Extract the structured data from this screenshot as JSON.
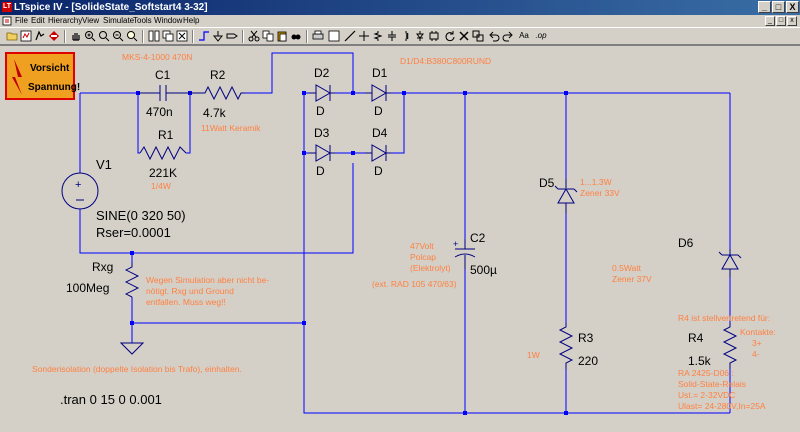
{
  "window": {
    "title": "LTspice IV - [SolideState_Softstart4  3-32]",
    "controls": [
      "_",
      "□",
      "X"
    ],
    "mdi_controls": [
      "_",
      "□",
      "x"
    ]
  },
  "menu": [
    "File",
    "Edit",
    "Hierarchy",
    "View",
    "Simulate",
    "Tools",
    "Window",
    "Help"
  ],
  "toolbar": {
    "text_tools": [
      "Aa",
      ".op"
    ]
  },
  "schematic": {
    "colors": {
      "wire": "#0000ff",
      "component": "#000080",
      "label": "#000000",
      "comment": "#ff8040",
      "warning_bg": "#f0a020",
      "warning_border": "#e00000"
    },
    "warning_sign": [
      "Vorsicht",
      "Spannung!"
    ],
    "components": {
      "c1": {
        "name": "C1",
        "value": "470n"
      },
      "r2": {
        "name": "R2",
        "value": "4.7k"
      },
      "r1": {
        "name": "R1",
        "value": "221K"
      },
      "v1": {
        "name": "V1",
        "value": "SINE(0 320 50)",
        "extra": "Rser=0.0001"
      },
      "d1": {
        "name": "D1",
        "value": "D"
      },
      "d2": {
        "name": "D2",
        "value": "D"
      },
      "d3": {
        "name": "D3",
        "value": "D"
      },
      "d4": {
        "name": "D4",
        "value": "D"
      },
      "d5": {
        "name": "D5"
      },
      "d6": {
        "name": "D6"
      },
      "c2": {
        "name": "C2",
        "value": "500µ"
      },
      "r3": {
        "name": "R3",
        "value": "220"
      },
      "r4": {
        "name": "R4",
        "value": "1.5k"
      },
      "rxg": {
        "name": "Rxg",
        "value": "100Meg"
      }
    },
    "comments": {
      "mks": "MKS-4-1000 470N",
      "bridge": "D1/D4:B380C800RUND",
      "r2_note": "11Watt Keramik",
      "r1_note": "1/4W",
      "d5_note": [
        "1...1.3W",
        "Zener 33V"
      ],
      "c2_note": [
        "47Volt",
        "Polcap",
        "(Elektrolyt)"
      ],
      "c2_ext": "(ext. RAD 105 470/63)",
      "rxg_note": [
        "Wegen Simulation aber nicht be-",
        "nötigt. Rxg und Ground",
        "entfallen. Muss weg!!"
      ],
      "d6_note": [
        "0.5Watt",
        "Zener 37V"
      ],
      "r3_note": "1W",
      "r4_note": "R4 ist stellvertretend für:",
      "kontakte": [
        "Kontakte:",
        "3+",
        "4-"
      ],
      "relais": [
        "RA 2425-D06 :",
        "Solid-State-Relais",
        "Ust.= 2-32VDC",
        "Ulast= 24-280V,In=25A"
      ],
      "isolation": "Sonderisolation (doppelte Isolation bis Trafo), einhalten."
    },
    "directive": ".tran 0 15 0 0.001"
  }
}
